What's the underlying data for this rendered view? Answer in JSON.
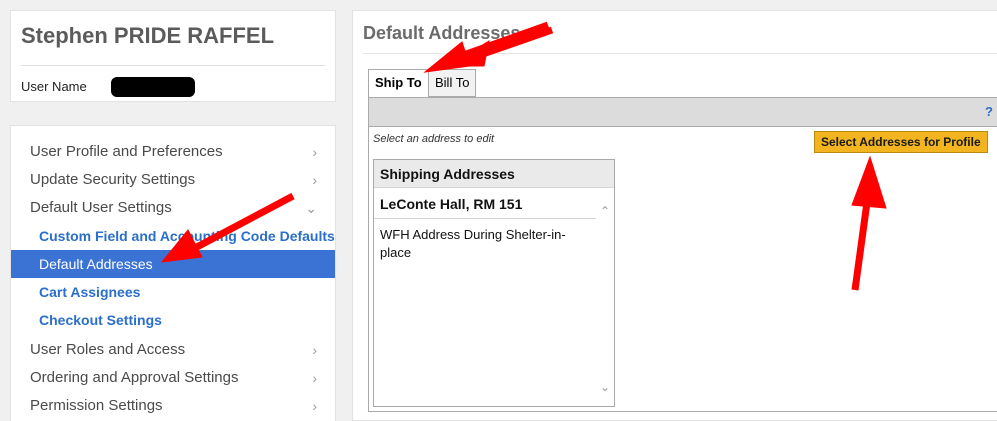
{
  "profile": {
    "name": "Stephen PRIDE RAFFEL",
    "username_label": "User Name"
  },
  "nav": {
    "items": [
      {
        "label": "User Profile and Preferences",
        "chevron": ">"
      },
      {
        "label": "Update Security Settings",
        "chevron": ">"
      },
      {
        "label": "Default User Settings",
        "chevron": "v"
      }
    ],
    "subitems": [
      {
        "label": "Custom Field and Accounting Code Defaults"
      },
      {
        "label": "Default Addresses"
      },
      {
        "label": "Cart Assignees"
      },
      {
        "label": "Checkout Settings"
      }
    ],
    "items_after": [
      {
        "label": "User Roles and Access",
        "chevron": ">"
      },
      {
        "label": "Ordering and Approval Settings",
        "chevron": ">"
      },
      {
        "label": "Permission Settings",
        "chevron": ">"
      }
    ]
  },
  "main": {
    "title": "Default Addresses",
    "tabs": [
      {
        "label": "Ship To",
        "active": true
      },
      {
        "label": "Bill To",
        "active": false
      }
    ],
    "help_icon": "?",
    "hint": "Select an address to edit",
    "select_button": "Select Addresses for Profile",
    "address_list": {
      "header": "Shipping Addresses",
      "items": [
        "LeConte Hall, RM 151",
        "WFH Address During Shelter-in-place"
      ]
    }
  },
  "colors": {
    "active_nav": "#3b73d4",
    "link": "#2a6fc9",
    "button": "#f2b51f",
    "annotation": "#ff0000"
  }
}
